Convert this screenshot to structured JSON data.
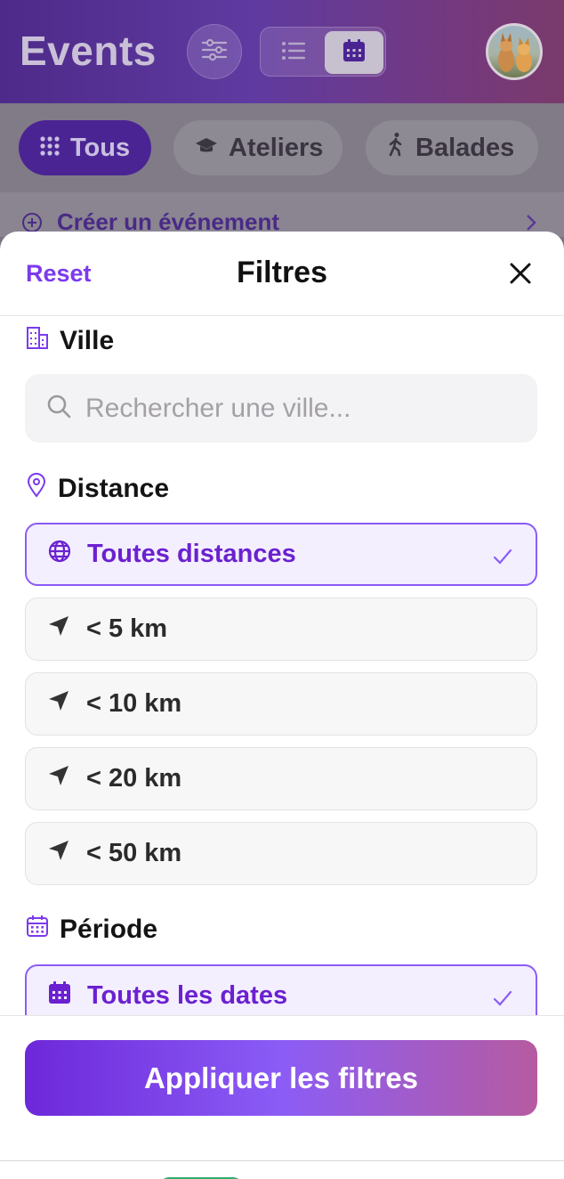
{
  "background": {
    "app_title": "Events",
    "chips": [
      {
        "label": "Tous",
        "icon": "grid-dots-icon",
        "active": true
      },
      {
        "label": "Ateliers",
        "icon": "graduation-cap-icon",
        "active": false
      },
      {
        "label": "Balades",
        "icon": "walking-icon",
        "active": false
      }
    ],
    "create_event_label": "Créer un événement"
  },
  "sheet": {
    "reset_label": "Reset",
    "title": "Filtres",
    "ville": {
      "label": "Ville",
      "search_placeholder": "Rechercher une ville..."
    },
    "distance": {
      "label": "Distance",
      "options": [
        {
          "label": "Toutes distances",
          "icon": "globe-icon",
          "selected": true
        },
        {
          "label": "< 5 km",
          "icon": "location-arrow-icon",
          "selected": false
        },
        {
          "label": "< 10 km",
          "icon": "location-arrow-icon",
          "selected": false
        },
        {
          "label": "< 20 km",
          "icon": "location-arrow-icon",
          "selected": false
        },
        {
          "label": "< 50 km",
          "icon": "location-arrow-icon",
          "selected": false
        }
      ]
    },
    "periode": {
      "label": "Période",
      "options": [
        {
          "label": "Toutes les dates",
          "icon": "calendar-icon",
          "selected": true
        }
      ]
    },
    "apply_label": "Appliquer les filtres"
  },
  "colors": {
    "accent": "#7c3aed",
    "selected_bg": "#f4efff",
    "header_gradient_start": "#4e2a8a",
    "header_gradient_end": "#7a3a6b"
  }
}
